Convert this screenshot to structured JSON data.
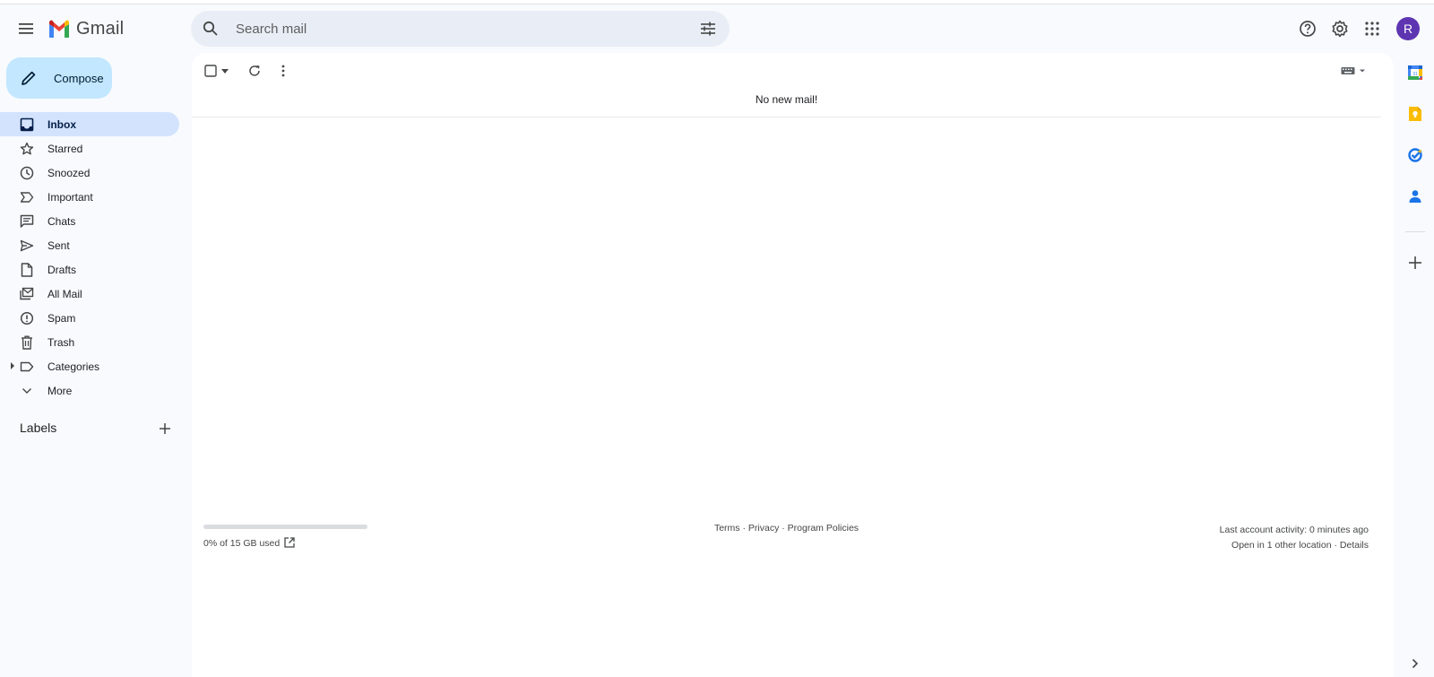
{
  "app": {
    "name": "Gmail"
  },
  "search": {
    "placeholder": "Search mail"
  },
  "account": {
    "initial": "R",
    "color": "#5e35b1"
  },
  "compose": {
    "label": "Compose"
  },
  "nav": {
    "items": [
      {
        "label": "Inbox",
        "icon": "inbox-icon",
        "active": true
      },
      {
        "label": "Starred",
        "icon": "star-icon"
      },
      {
        "label": "Snoozed",
        "icon": "clock-icon"
      },
      {
        "label": "Important",
        "icon": "important-icon"
      },
      {
        "label": "Chats",
        "icon": "chat-icon"
      },
      {
        "label": "Sent",
        "icon": "send-icon"
      },
      {
        "label": "Drafts",
        "icon": "draft-icon"
      },
      {
        "label": "All Mail",
        "icon": "all-mail-icon"
      },
      {
        "label": "Spam",
        "icon": "spam-icon"
      },
      {
        "label": "Trash",
        "icon": "trash-icon"
      },
      {
        "label": "Categories",
        "icon": "label-icon"
      },
      {
        "label": "More",
        "icon": "chevron-down-icon"
      }
    ]
  },
  "labels": {
    "title": "Labels"
  },
  "main": {
    "empty_message": "No new mail!",
    "storage": {
      "text": "0% of 15 GB used",
      "fraction_used": 0.0
    },
    "footer": {
      "terms": "Terms",
      "privacy": "Privacy",
      "policies": "Program Policies",
      "separator": " · "
    },
    "activity": {
      "line1": "Last account activity: 0 minutes ago",
      "line2_a": "Open in 1 other location",
      "line2_sep": " · ",
      "line2_b": "Details"
    }
  },
  "colors": {
    "accent": "#c2e7ff",
    "active_nav": "#d3e3fd",
    "background": "#f8fafd"
  }
}
